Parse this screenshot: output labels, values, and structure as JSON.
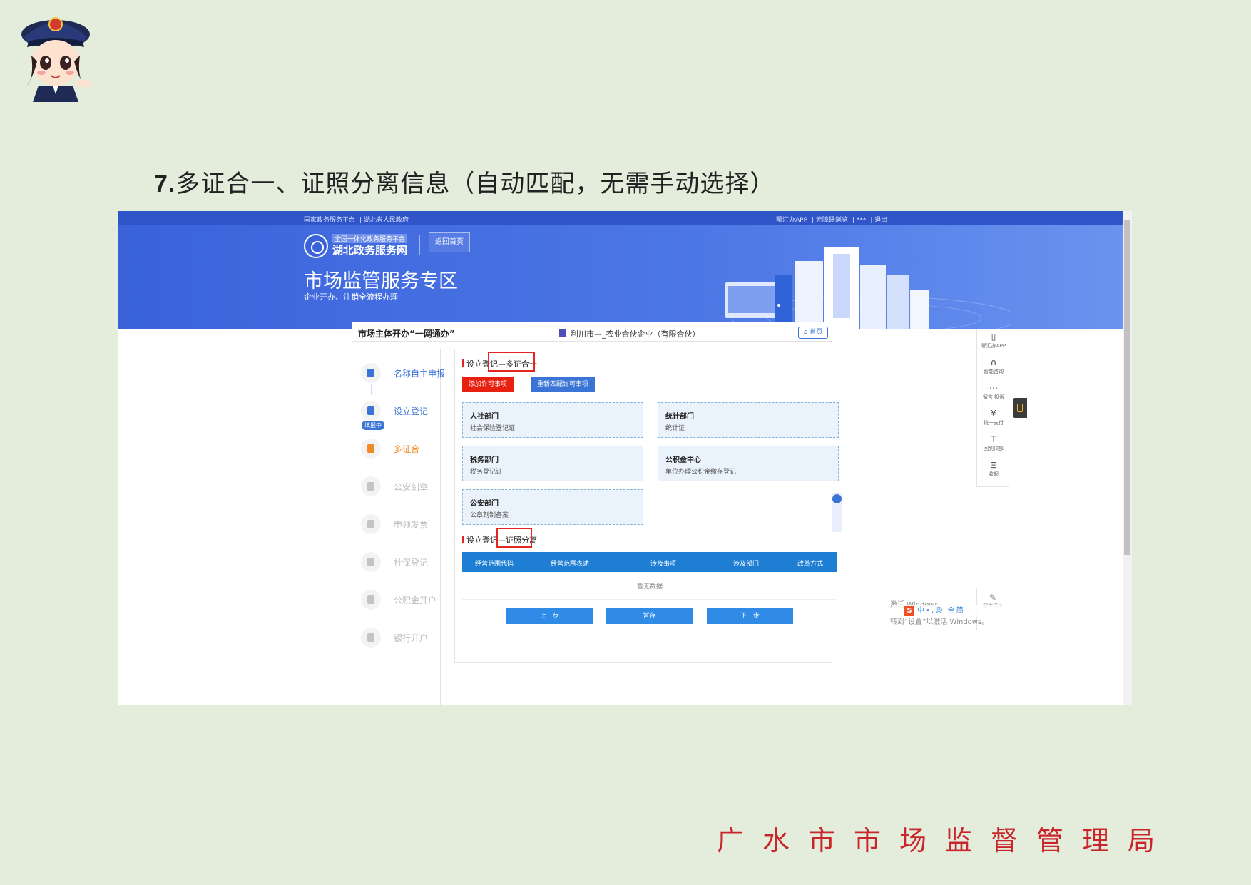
{
  "slide": {
    "number": "7.",
    "title": "多证合一、证照分离信息（自动匹配，无需手动选择）",
    "footer_org": "广水市市场监督管理局"
  },
  "browser": {
    "topbar_left": [
      "国家政务服务平台",
      "湖北省人民政府"
    ],
    "topbar_right": [
      "鄂汇办APP",
      "无障碍浏览",
      "***",
      "退出"
    ],
    "site_small": "全国一体化政务服务平台",
    "site_name": "湖北政务服务网",
    "home_button": "返回首页",
    "zone_title": "市场监管服务专区",
    "zone_sub": "企业开办、注销全流程办理"
  },
  "app": {
    "card_title": "市场主体开办“一网通办”",
    "enterprise": "利川市—_农业合伙企业（有限合伙）",
    "home_btn": "首页",
    "steps": [
      {
        "label": "名称自主申报",
        "state": "done"
      },
      {
        "label": "设立登记",
        "state": "done"
      },
      {
        "label": "多证合一",
        "state": "current"
      },
      {
        "label": "公安刻章",
        "state": "todo"
      },
      {
        "label": "申领发票",
        "state": "todo"
      },
      {
        "label": "社保登记",
        "state": "todo"
      },
      {
        "label": "公积金开户",
        "state": "todo"
      },
      {
        "label": "银行开户",
        "state": "todo"
      }
    ],
    "step_badge": "填报中",
    "section1_title": "设立登记—多证合一",
    "btn_add": "添加许可事项",
    "btn_rematch": "重新匹配许可事项",
    "departments": [
      {
        "dept": "人社部门",
        "cert": "社会保险登记证"
      },
      {
        "dept": "统计部门",
        "cert": "统计证"
      },
      {
        "dept": "税务部门",
        "cert": "税务登记证"
      },
      {
        "dept": "公积金中心",
        "cert": "单位办理公积金缴存登记"
      },
      {
        "dept": "公安部门",
        "cert": "公章刻制备案"
      }
    ],
    "section2_title": "设立登记—证照分离",
    "table_headers": [
      "经营范围代码",
      "经营范围表述",
      "涉及事项",
      "涉及部门",
      "改革方式"
    ],
    "table_empty": "暂无数据",
    "buttons": {
      "prev": "上一步",
      "save": "暂存",
      "next": "下一步"
    },
    "side_tools": [
      {
        "icon": "phone-icon",
        "glyph": "▯",
        "label": "鄂汇办APP"
      },
      {
        "icon": "headset-icon",
        "glyph": "∩",
        "label": "智能咨询"
      },
      {
        "icon": "message-icon",
        "glyph": "⋯",
        "label": "留言 投诉"
      },
      {
        "icon": "yuan-icon",
        "glyph": "¥",
        "label": "统一支付"
      },
      {
        "icon": "top-icon",
        "glyph": "⊤",
        "label": "回到顶部"
      },
      {
        "icon": "collapse-icon",
        "glyph": "⊟",
        "label": "收起"
      }
    ],
    "side_tool2": {
      "glyph": "✎",
      "label": "留言评价"
    },
    "float_phone": "市场监管",
    "watermark_line1": "激活 Windows",
    "watermark_line2": "转到“设置”以激活 Windows。",
    "ime": "中 • , ☺   全 简"
  },
  "colors": {
    "accent_blue": "#3a74d6",
    "banner_blue": "#3a63da",
    "active_orange": "#f08a24",
    "highlight_red": "#e3261f",
    "footer_red": "#c9262c"
  }
}
